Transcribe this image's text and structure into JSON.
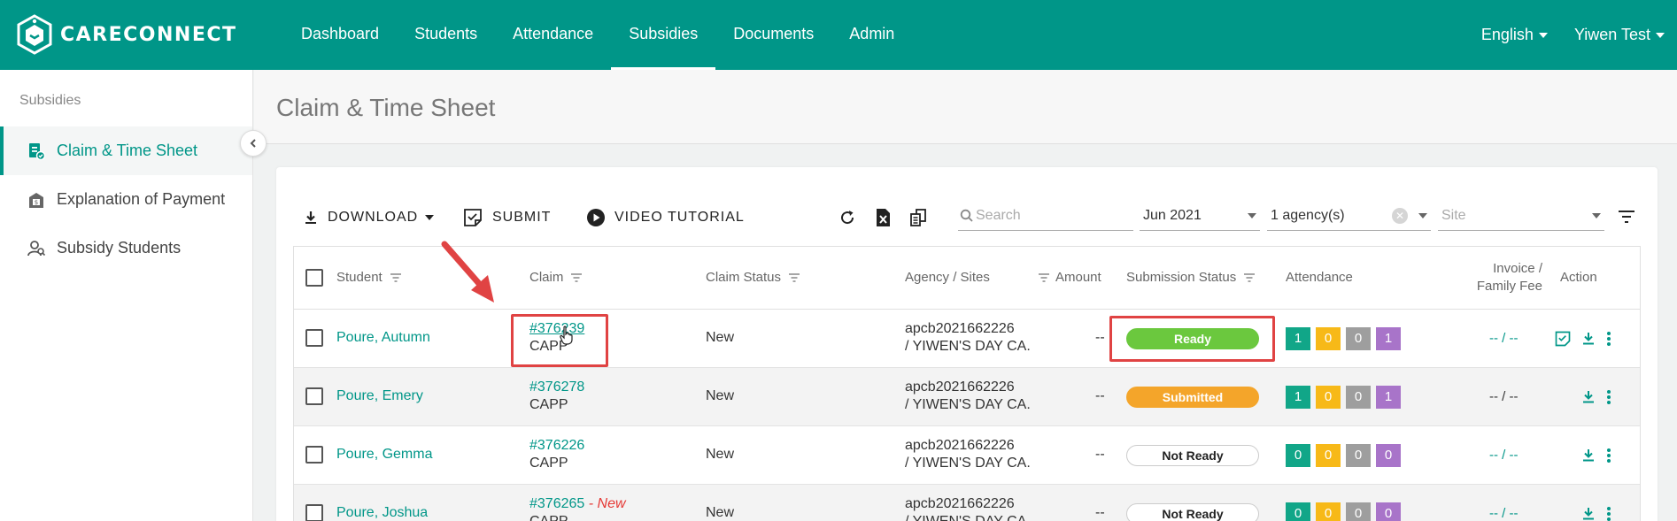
{
  "app": {
    "brand": "CARECONNECT"
  },
  "nav": {
    "items": [
      {
        "label": "Dashboard"
      },
      {
        "label": "Students"
      },
      {
        "label": "Attendance"
      },
      {
        "label": "Subsidies",
        "active": true
      },
      {
        "label": "Documents"
      },
      {
        "label": "Admin"
      }
    ],
    "language": "English",
    "user": "Yiwen Test"
  },
  "sidebar": {
    "title": "Subsidies",
    "items": [
      {
        "label": "Claim & Time Sheet",
        "active": true,
        "icon": "claim-sheet-icon"
      },
      {
        "label": "Explanation of Payment",
        "icon": "payment-icon"
      },
      {
        "label": "Subsidy Students",
        "icon": "student-search-icon"
      }
    ]
  },
  "page": {
    "title": "Claim & Time Sheet"
  },
  "toolbar": {
    "download": "DOWNLOAD",
    "submit": "SUBMIT",
    "video": "VIDEO TUTORIAL",
    "search_placeholder": "Search",
    "month": "Jun 2021",
    "agency": "1 agency(s)",
    "site_placeholder": "Site"
  },
  "table": {
    "headers": {
      "student": "Student",
      "claim": "Claim",
      "claim_status": "Claim Status",
      "agency": "Agency / Sites",
      "amount": "Amount",
      "submission": "Submission Status",
      "attendance": "Attendance",
      "invoice_line1": "Invoice /",
      "invoice_line2": "Family Fee",
      "action": "Action"
    },
    "rows": [
      {
        "student": "Poure, Autumn",
        "claim": "#376239",
        "program": "CAPP",
        "new_tag": "",
        "claim_status": "New",
        "agency": "apcb2021662226",
        "site": "/ YIWEN'S DAY CA.",
        "amount": "--",
        "submission": "Ready",
        "att": [
          "1",
          "0",
          "0",
          "1"
        ],
        "invoice": "-- / --"
      },
      {
        "student": "Poure, Emery",
        "claim": "#376278",
        "program": "CAPP",
        "new_tag": "",
        "claim_status": "New",
        "agency": "apcb2021662226",
        "site": "/ YIWEN'S DAY CA.",
        "amount": "--",
        "submission": "Submitted",
        "att": [
          "1",
          "0",
          "0",
          "1"
        ],
        "invoice": "-- / --"
      },
      {
        "student": "Poure, Gemma",
        "claim": "#376226",
        "program": "CAPP",
        "new_tag": "",
        "claim_status": "New",
        "agency": "apcb2021662226",
        "site": "/ YIWEN'S DAY CA.",
        "amount": "--",
        "submission": "Not Ready",
        "att": [
          "0",
          "0",
          "0",
          "0"
        ],
        "invoice": "-- / --"
      },
      {
        "student": "Poure, Joshua",
        "claim": "#376265",
        "program": "CAPP",
        "new_tag": "- New",
        "claim_status": "New",
        "agency": "apcb2021662226",
        "site": "/ YIWEN'S DAY CA.",
        "amount": "--",
        "submission": "Not Ready",
        "att": [
          "0",
          "0",
          "0",
          "0"
        ],
        "invoice": "-- / --"
      }
    ]
  },
  "colors": {
    "brand": "#009688",
    "ready": "#6bc83e",
    "submitted": "#f4a52a",
    "annotation": "#e04343"
  }
}
